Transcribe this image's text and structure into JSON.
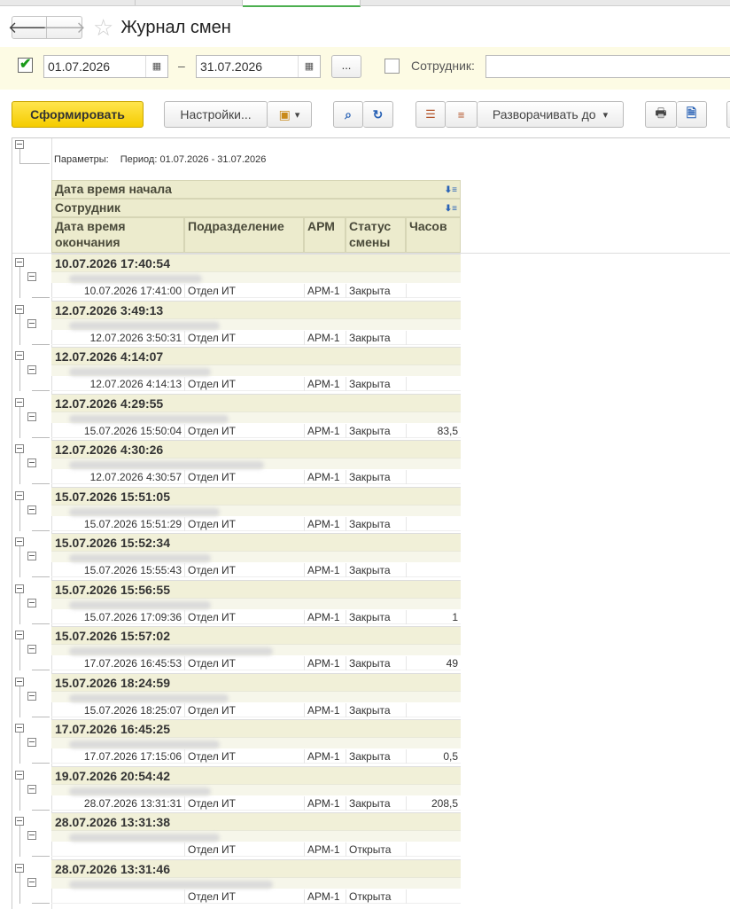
{
  "window": {
    "title": "Журнал смен"
  },
  "nav": {
    "back": "🡐",
    "forward": "🡒"
  },
  "filter": {
    "period_enabled": true,
    "date_from": "01.07.2026",
    "date_sep": "–",
    "date_to": "31.07.2026",
    "choose_label": "...",
    "employee_enabled": false,
    "employee_label": "Сотрудник:",
    "employee_value": ""
  },
  "toolbar": {
    "generate_label": "Сформировать",
    "settings_label": "Настройки...",
    "expand_label": "Разворачивать до",
    "dropdown_arrow": "▾"
  },
  "report": {
    "params_label": "Параметры:",
    "period_text": "Период: 01.07.2026 - 31.07.2026",
    "headers": {
      "start": "Дата время начала",
      "employee": "Сотрудник",
      "end_l1": "Дата время",
      "end_l2": "окончания",
      "department": "Подразделение",
      "arm": "АРМ",
      "status_l1": "Статус",
      "status_l2": "смены",
      "hours": "Часов"
    },
    "groups": [
      {
        "start": "10.07.2026 17:40:54",
        "end": "10.07.2026 17:41:00",
        "dept": "Отдел ИТ",
        "arm": "АРМ-1",
        "status": "Закрыта",
        "hours": ""
      },
      {
        "start": "12.07.2026 3:49:13",
        "end": "12.07.2026 3:50:31",
        "dept": "Отдел ИТ",
        "arm": "АРМ-1",
        "status": "Закрыта",
        "hours": ""
      },
      {
        "start": "12.07.2026 4:14:07",
        "end": "12.07.2026 4:14:13",
        "dept": "Отдел ИТ",
        "arm": "АРМ-1",
        "status": "Закрыта",
        "hours": ""
      },
      {
        "start": "12.07.2026 4:29:55",
        "end": "15.07.2026 15:50:04",
        "dept": "Отдел ИТ",
        "arm": "АРМ-1",
        "status": "Закрыта",
        "hours": "83,5"
      },
      {
        "start": "12.07.2026 4:30:26",
        "end": "12.07.2026 4:30:57",
        "dept": "Отдел ИТ",
        "arm": "АРМ-1",
        "status": "Закрыта",
        "hours": ""
      },
      {
        "start": "15.07.2026 15:51:05",
        "end": "15.07.2026 15:51:29",
        "dept": "Отдел ИТ",
        "arm": "АРМ-1",
        "status": "Закрыта",
        "hours": ""
      },
      {
        "start": "15.07.2026 15:52:34",
        "end": "15.07.2026 15:55:43",
        "dept": "Отдел ИТ",
        "arm": "АРМ-1",
        "status": "Закрыта",
        "hours": ""
      },
      {
        "start": "15.07.2026 15:56:55",
        "end": "15.07.2026 17:09:36",
        "dept": "Отдел ИТ",
        "arm": "АРМ-1",
        "status": "Закрыта",
        "hours": "1"
      },
      {
        "start": "15.07.2026 15:57:02",
        "end": "17.07.2026 16:45:53",
        "dept": "Отдел ИТ",
        "arm": "АРМ-1",
        "status": "Закрыта",
        "hours": "49"
      },
      {
        "start": "15.07.2026 18:24:59",
        "end": "15.07.2026 18:25:07",
        "dept": "Отдел ИТ",
        "arm": "АРМ-1",
        "status": "Закрыта",
        "hours": ""
      },
      {
        "start": "17.07.2026 16:45:25",
        "end": "17.07.2026 17:15:06",
        "dept": "Отдел ИТ",
        "arm": "АРМ-1",
        "status": "Закрыта",
        "hours": "0,5"
      },
      {
        "start": "19.07.2026 20:54:42",
        "end": "28.07.2026 13:31:31",
        "dept": "Отдел ИТ",
        "arm": "АРМ-1",
        "status": "Закрыта",
        "hours": "208,5"
      },
      {
        "start": "28.07.2026 13:31:38",
        "end": "",
        "dept": "Отдел ИТ",
        "arm": "АРМ-1",
        "status": "Открыта",
        "hours": ""
      },
      {
        "start": "28.07.2026 13:31:46",
        "end": "",
        "dept": "Отдел ИТ",
        "arm": "АРМ-1",
        "status": "Открыта",
        "hours": ""
      }
    ]
  }
}
